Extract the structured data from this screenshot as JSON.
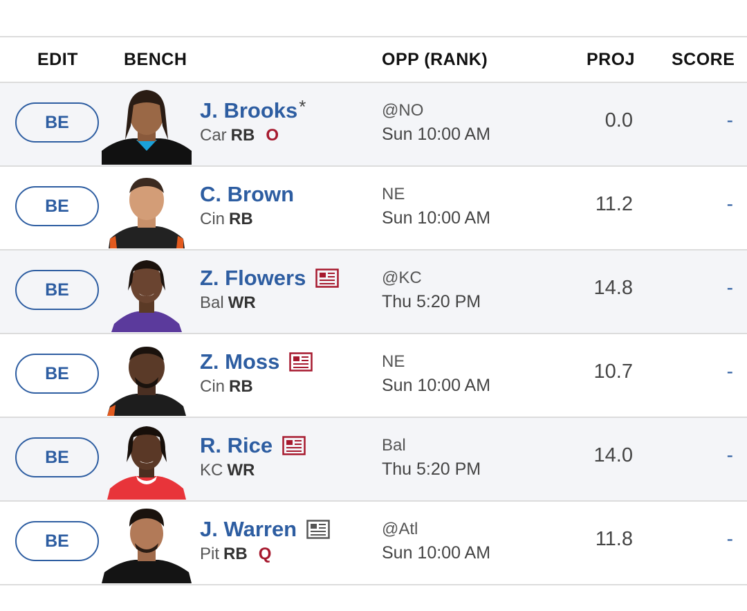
{
  "header": {
    "edit": "EDIT",
    "bench": "BENCH",
    "opp": "OPP (RANK)",
    "proj": "PROJ",
    "score": "SCORE"
  },
  "colors": {
    "link_blue": "#2d5da1",
    "status_red": "#a6192e",
    "row_alt_bg": "#f4f5f8",
    "news_red": "#a6192e",
    "news_gray": "#555555"
  },
  "players": [
    {
      "slot": "BE",
      "name": "J. Brooks",
      "star": "*",
      "team": "Car",
      "pos": "RB",
      "status": "O",
      "news_icon": "",
      "opp": "@NO",
      "game": "Sun 10:00 AM",
      "proj": "0.0",
      "score": "-",
      "avatar_icon": "player-headshot-icon"
    },
    {
      "slot": "BE",
      "name": "C. Brown",
      "star": "",
      "team": "Cin",
      "pos": "RB",
      "status": "",
      "news_icon": "",
      "opp": "NE",
      "game": "Sun 10:00 AM",
      "proj": "11.2",
      "score": "-",
      "avatar_icon": "player-headshot-icon"
    },
    {
      "slot": "BE",
      "name": "Z. Flowers",
      "star": "",
      "team": "Bal",
      "pos": "WR",
      "status": "",
      "news_icon": "news-icon-red",
      "opp": "@KC",
      "game": "Thu 5:20 PM",
      "proj": "14.8",
      "score": "-",
      "avatar_icon": "player-headshot-icon"
    },
    {
      "slot": "BE",
      "name": "Z. Moss",
      "star": "",
      "team": "Cin",
      "pos": "RB",
      "status": "",
      "news_icon": "news-icon-red",
      "opp": "NE",
      "game": "Sun 10:00 AM",
      "proj": "10.7",
      "score": "-",
      "avatar_icon": "player-headshot-icon"
    },
    {
      "slot": "BE",
      "name": "R. Rice",
      "star": "",
      "team": "KC",
      "pos": "WR",
      "status": "",
      "news_icon": "news-icon-red",
      "opp": "Bal",
      "game": "Thu 5:20 PM",
      "proj": "14.0",
      "score": "-",
      "avatar_icon": "player-headshot-icon"
    },
    {
      "slot": "BE",
      "name": "J. Warren",
      "star": "",
      "team": "Pit",
      "pos": "RB",
      "status": "Q",
      "news_icon": "news-icon-gray",
      "opp": "@Atl",
      "game": "Sun 10:00 AM",
      "proj": "11.8",
      "score": "-",
      "avatar_icon": "player-headshot-icon"
    }
  ]
}
